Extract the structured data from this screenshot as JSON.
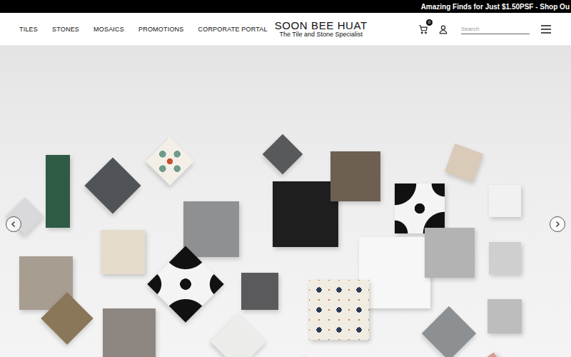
{
  "announcement": "Amazing Finds for Just $1.50PSF - Shop Ou",
  "nav": [
    {
      "label": "TILES"
    },
    {
      "label": "STONES"
    },
    {
      "label": "MOSAICS"
    },
    {
      "label": "PROMOTIONS"
    },
    {
      "label": "CORPORATE PORTAL"
    }
  ],
  "logo": {
    "title": "SOON BEE HUAT",
    "tagline": "The Tile and Stone Specialist"
  },
  "cart": {
    "count": "0"
  },
  "search": {
    "placeholder": "Search"
  }
}
